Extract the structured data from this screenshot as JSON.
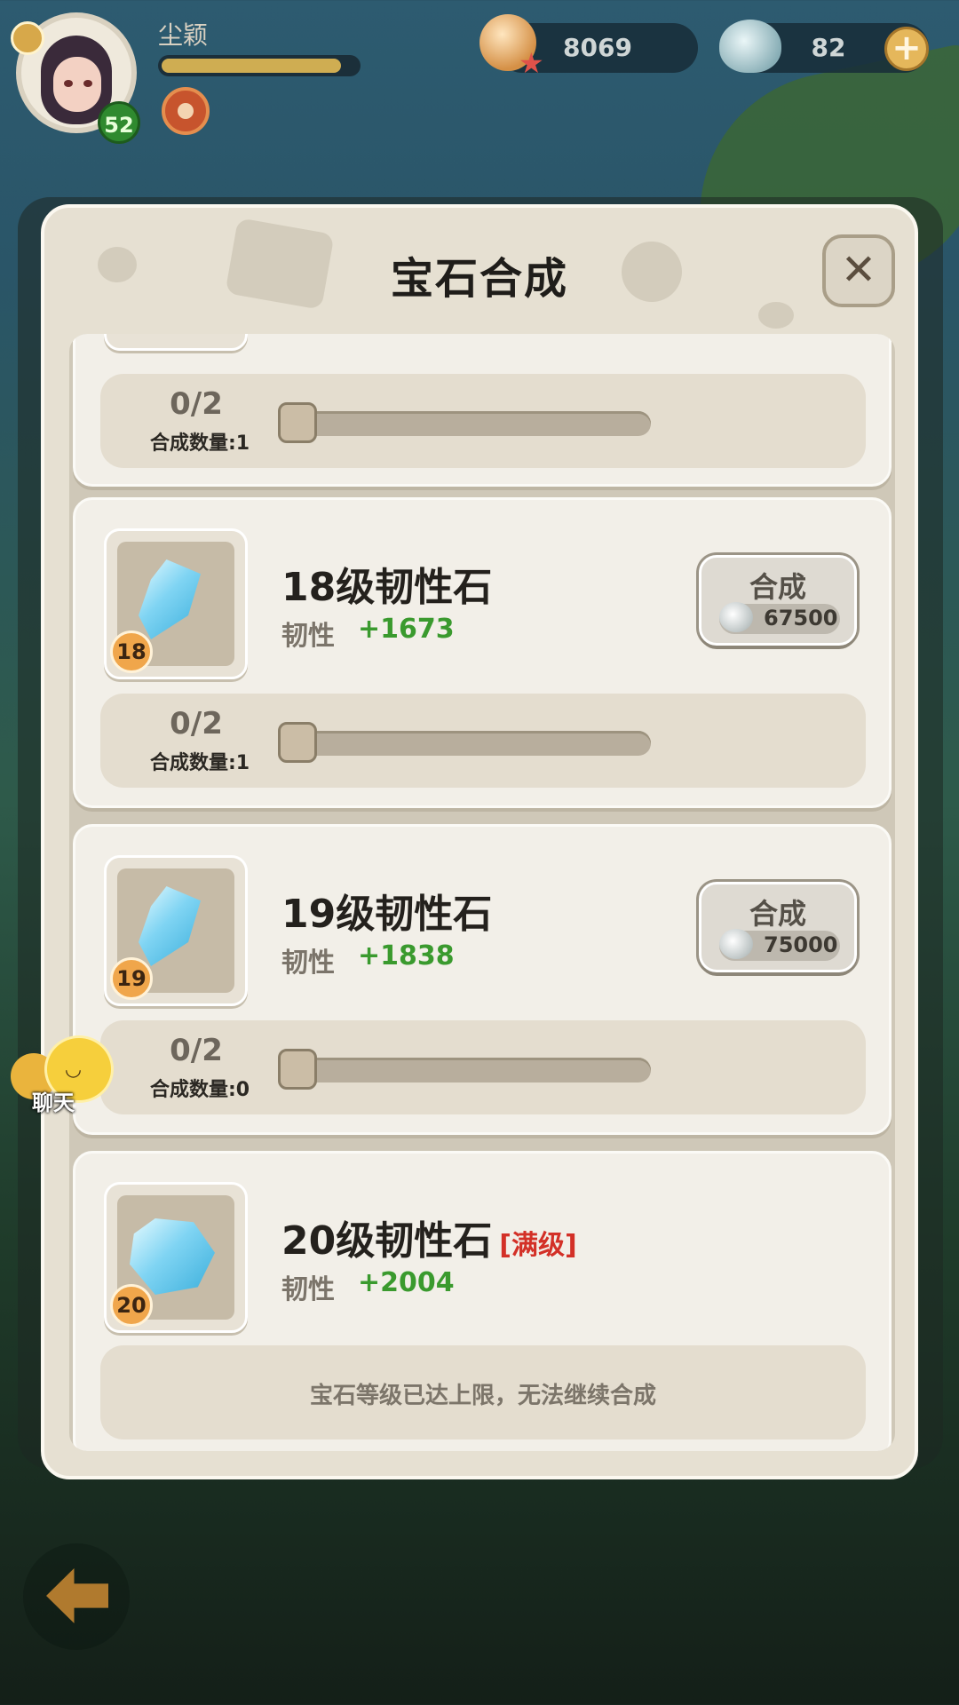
{
  "hud": {
    "player_name": "尘颖",
    "player_level": "52",
    "xp_progress": 0.92,
    "shell_currency": "8069",
    "pearl_currency": "82",
    "add_currency_label": "+"
  },
  "dialog": {
    "title": "宝石合成",
    "close_label": "✕"
  },
  "partial_card": {
    "progress": "0/2",
    "count": "合成数量:1"
  },
  "gems": [
    {
      "level": "18",
      "name": "18级韧性石",
      "stat_label": "韧性",
      "stat_value": "+1673",
      "button_label": "合成",
      "cost": "67500",
      "progress": "0/2",
      "count": "合成数量:1"
    },
    {
      "level": "19",
      "name": "19级韧性石",
      "stat_label": "韧性",
      "stat_value": "+1838",
      "button_label": "合成",
      "cost": "75000",
      "progress": "0/2",
      "count": "合成数量:0"
    },
    {
      "level": "20",
      "name": "20级韧性石",
      "max_tag": "[满级]",
      "stat_label": "韧性",
      "stat_value": "+2004",
      "maxed_note": "宝石等级已达上限，无法继续合成"
    }
  ],
  "chat": {
    "label": "聊天"
  },
  "icons": {
    "back": "back-arrow-icon",
    "chat": "chat-face-icon",
    "shell": "shell-currency-icon",
    "pearl": "pearl-currency-icon"
  },
  "colors": {
    "stat_green": "#3a9a2e",
    "max_red": "#d33027",
    "panel": "#f2efe8"
  }
}
